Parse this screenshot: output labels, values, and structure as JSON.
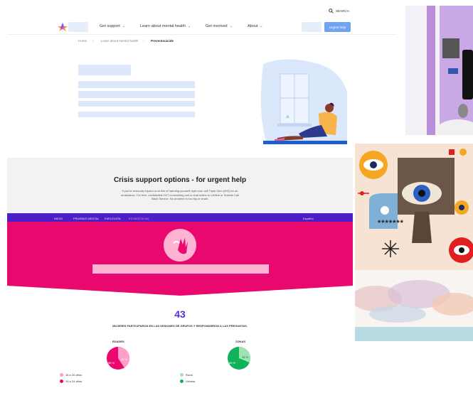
{
  "site": {
    "search_label": "SEARCH",
    "nav": [
      {
        "label": "Get support"
      },
      {
        "label": "Learn about mental health"
      },
      {
        "label": "Get involved"
      },
      {
        "label": "About"
      }
    ],
    "cta_label": "Urgent help",
    "breadcrumb": [
      "Home",
      "Learn about mental health",
      "Preventsuicide"
    ]
  },
  "crisis": {
    "title": "Crisis support options - for urgent help",
    "body": "If you're seriously injured or at risk of harming yourself right now, call Triple Zero (000) for an ambulance. For free, confidential 24/7 counselling call or chat online to Lifeline or Suicide Call Back Service. No problem is too big or small."
  },
  "spanish": {
    "nav": [
      "INICIO",
      "PRUEBAS MENTAL",
      "ENFLEXIÓN",
      "ESTADÍSTICAS"
    ],
    "lang": "Español",
    "stat_number": "43",
    "stat_caption": "MUJERES PARTICIPARON EN LAS SESIONES DE GRUPOS Y RESPONDIERON A LAS PREGUNTAS.",
    "chart_left": {
      "title": "EDADES",
      "legend": [
        "16 a 20 años",
        "14 a 24 años"
      ],
      "big_label": "58 %",
      "small_label": "42 %"
    },
    "chart_right": {
      "title": "ZONAS",
      "legend": [
        "Rural",
        "Urbana"
      ],
      "big_label": "66 %",
      "small_label": "34 %"
    }
  },
  "art": {
    "password": "*******"
  }
}
